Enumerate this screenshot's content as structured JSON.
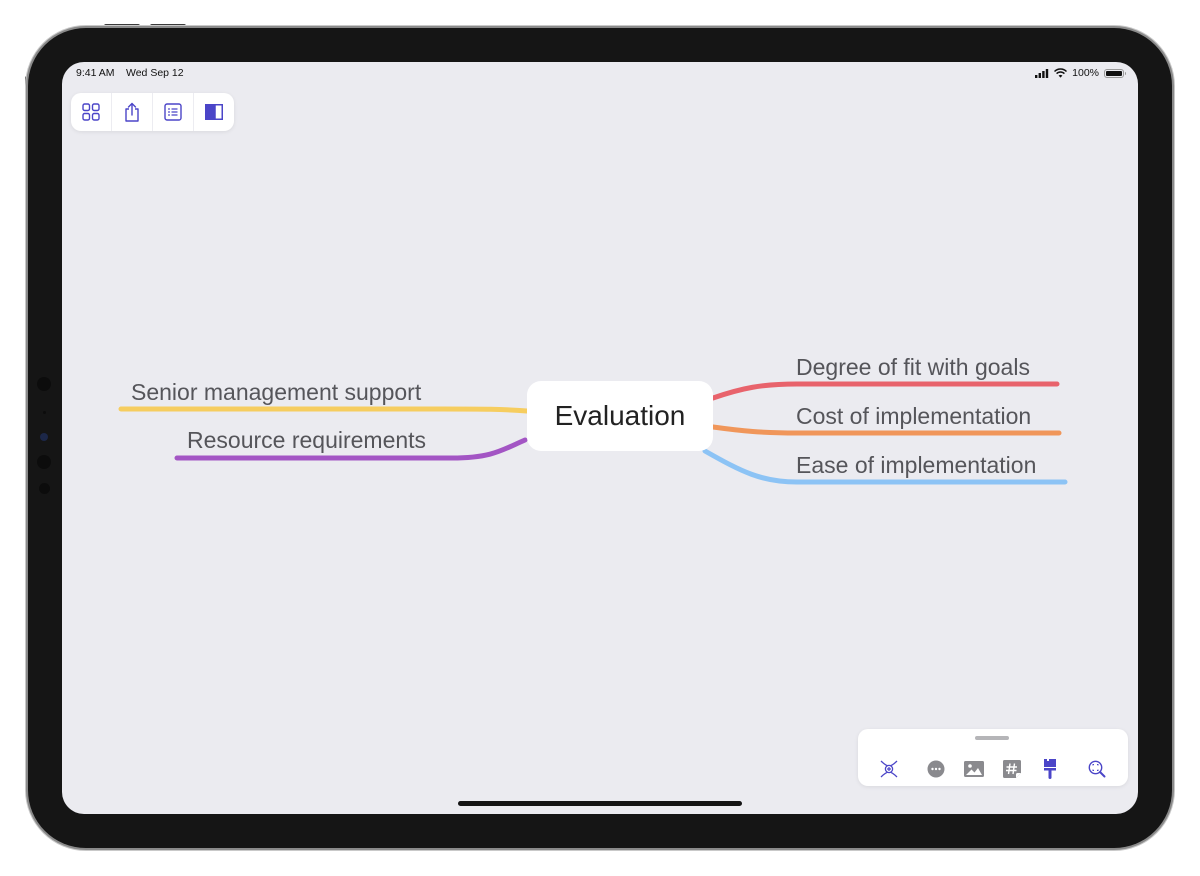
{
  "status_bar": {
    "time": "9:41 AM",
    "date": "Wed Sep 12",
    "battery": "100%",
    "battery_level": 1.0,
    "icons": [
      "cellular-signal-icon",
      "wifi-icon",
      "battery-icon"
    ]
  },
  "toolbar": {
    "buttons": [
      {
        "name": "grid-view-button",
        "icon": "grid-icon"
      },
      {
        "name": "share-button",
        "icon": "share-icon"
      },
      {
        "name": "outline-button",
        "icon": "list-icon"
      },
      {
        "name": "sidebar-toggle-button",
        "icon": "sidebar-icon"
      }
    ]
  },
  "mindmap": {
    "central_topic": "Evaluation",
    "branches": [
      {
        "label": "Degree of fit with goals",
        "side": "right",
        "color": "#e8636c"
      },
      {
        "label": "Cost of implementation",
        "side": "right",
        "color": "#f0965a"
      },
      {
        "label": "Ease of implementation",
        "side": "right",
        "color": "#8cc3f5"
      },
      {
        "label": "Senior management support",
        "side": "left",
        "color": "#f6cd5f"
      },
      {
        "label": "Resource requirements",
        "side": "left",
        "color": "#a355c4"
      }
    ]
  },
  "bottom_toolbar": {
    "buttons": [
      {
        "name": "add-topic-button",
        "icon": "topic-icon"
      },
      {
        "name": "more-button",
        "icon": "more-icon"
      },
      {
        "name": "image-button",
        "icon": "image-icon"
      },
      {
        "name": "tag-button",
        "icon": "hashtag-icon"
      },
      {
        "name": "style-button",
        "icon": "paintbrush-icon"
      },
      {
        "name": "zoom-fit-button",
        "icon": "zoom-icon"
      }
    ]
  },
  "colors": {
    "accent": "#4b45c8",
    "canvas": "#ebebf0",
    "icon_gray": "#8a8a8e"
  }
}
